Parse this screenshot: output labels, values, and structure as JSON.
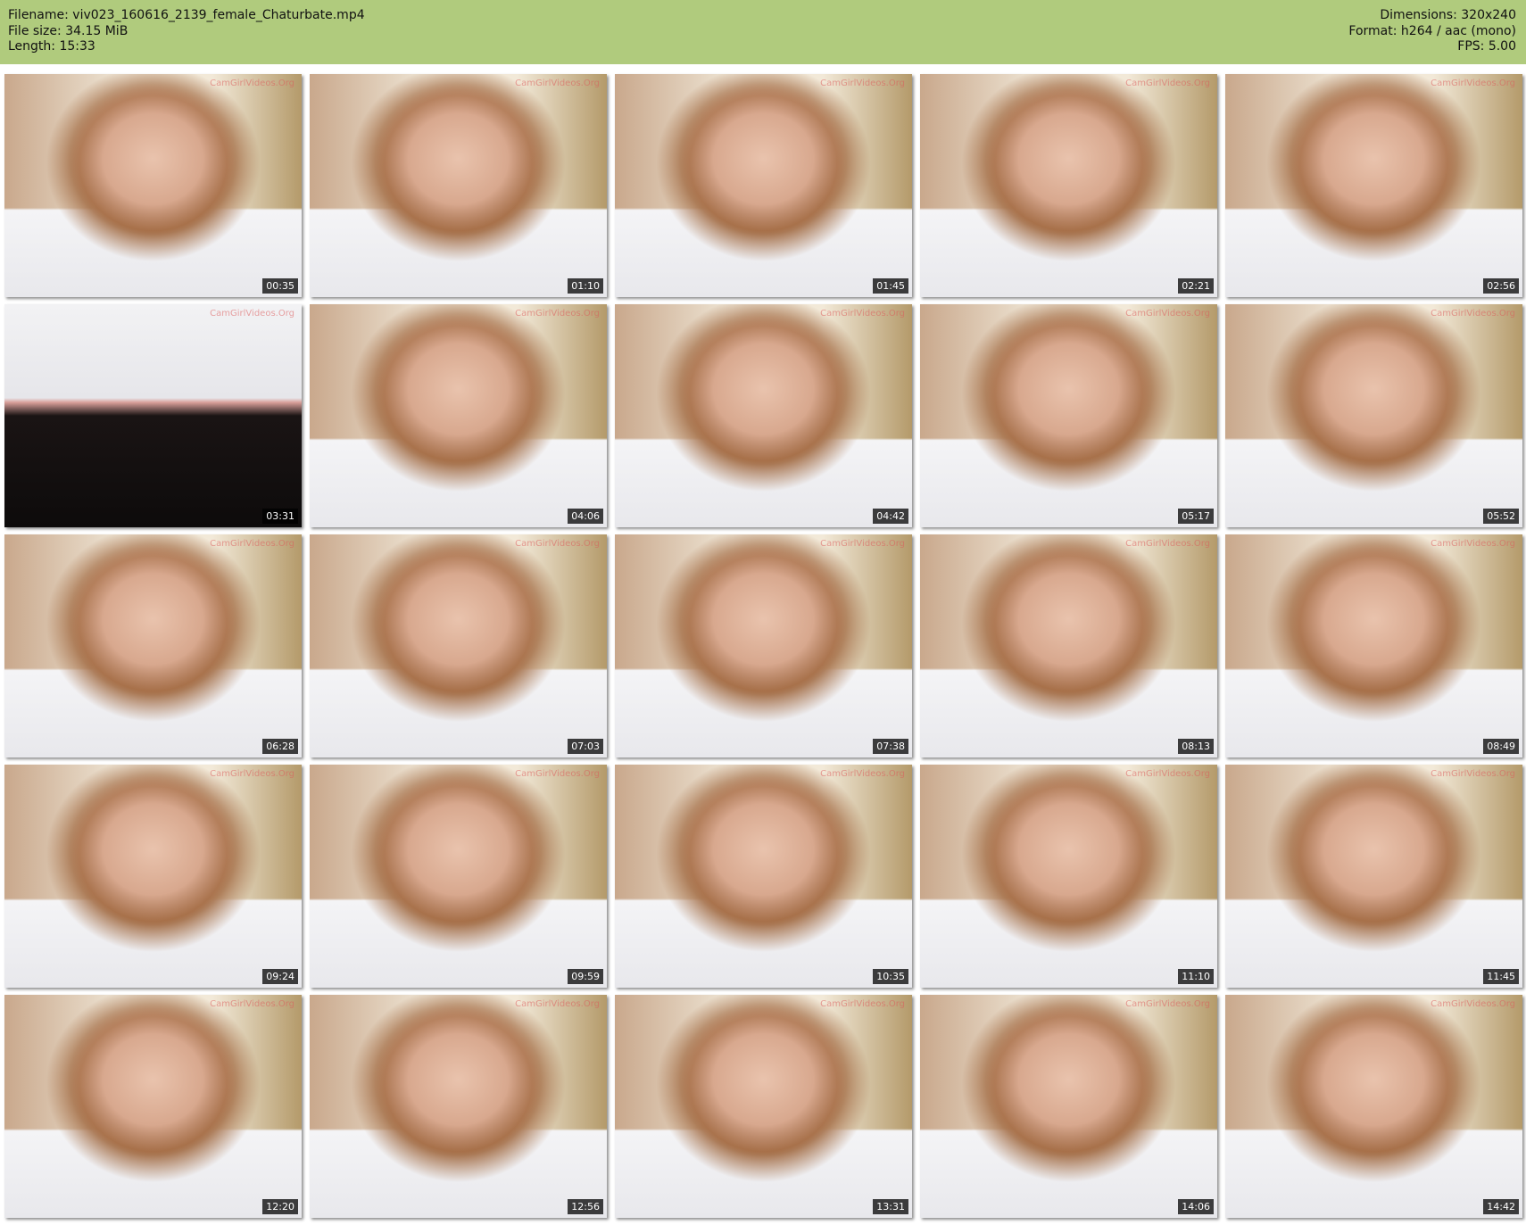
{
  "header": {
    "filename": "Filename: viv023_160616_2139_female_Chaturbate.mp4",
    "file_size": "File size: 34.15 MiB",
    "length": "Length: 15:33",
    "dimensions": "Dimensions: 320x240",
    "format": "Format: h264 / aac (mono)",
    "fps": "FPS: 5.00"
  },
  "watermark": "CamGirlVideos.Org",
  "colors": {
    "header_bg": "#b0cb7d"
  },
  "thumbnails": [
    {
      "time": "00:35"
    },
    {
      "time": "01:10"
    },
    {
      "time": "01:45"
    },
    {
      "time": "02:21"
    },
    {
      "time": "02:56"
    },
    {
      "time": "03:31",
      "variant": "dark"
    },
    {
      "time": "04:06"
    },
    {
      "time": "04:42"
    },
    {
      "time": "05:17"
    },
    {
      "time": "05:52"
    },
    {
      "time": "06:28"
    },
    {
      "time": "07:03"
    },
    {
      "time": "07:38"
    },
    {
      "time": "08:13"
    },
    {
      "time": "08:49"
    },
    {
      "time": "09:24"
    },
    {
      "time": "09:59"
    },
    {
      "time": "10:35"
    },
    {
      "time": "11:10"
    },
    {
      "time": "11:45"
    },
    {
      "time": "12:20"
    },
    {
      "time": "12:56"
    },
    {
      "time": "13:31"
    },
    {
      "time": "14:06"
    },
    {
      "time": "14:42"
    }
  ]
}
